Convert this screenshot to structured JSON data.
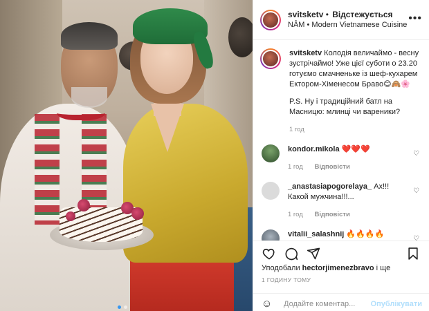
{
  "post": {
    "username": "svitsketv",
    "follow_label": "Відстежується",
    "location": "NÂM • Modern Vietnamese Cuisine",
    "more_icon": "more-horizontal-icon"
  },
  "caption": {
    "username": "svitsketv",
    "text": "Колодія величаймо - весну зустрічаймо! Уже цієї суботи о 23.20 готуємо смачненьке із шеф-кухарем Ектором-Хіменесом Браво😊🙈🌸",
    "ps": "P.S. Ну і традиційний батл на Масницю: млинці чи вареники?",
    "time": "1 год"
  },
  "comments": [
    {
      "username": "kondor.mikola",
      "text": "❤️❤️❤️",
      "time": "1 год",
      "reply": "Відповісти"
    },
    {
      "username": "_anastasiapogorelaya_",
      "text": "Ах!!! Какой мужчина!!!...",
      "time": "1 год",
      "reply": "Відповісти"
    },
    {
      "username": "vitalii_salashnij",
      "text": "🔥🔥🔥🔥",
      "time": "",
      "reply": ""
    }
  ],
  "likes": {
    "prefix": "Уподобали",
    "user": "hectorjimenezbravo",
    "suffix": "і ще"
  },
  "timestamp": "1 ГОДИНУ ТОМУ",
  "add_comment": {
    "placeholder": "Додайте коментар...",
    "publish": "Опублікувати"
  },
  "colors": {
    "link": "#3897f0",
    "publish_disabled": "#b2dffc",
    "muted": "#8e8e8e",
    "text": "#262626"
  }
}
